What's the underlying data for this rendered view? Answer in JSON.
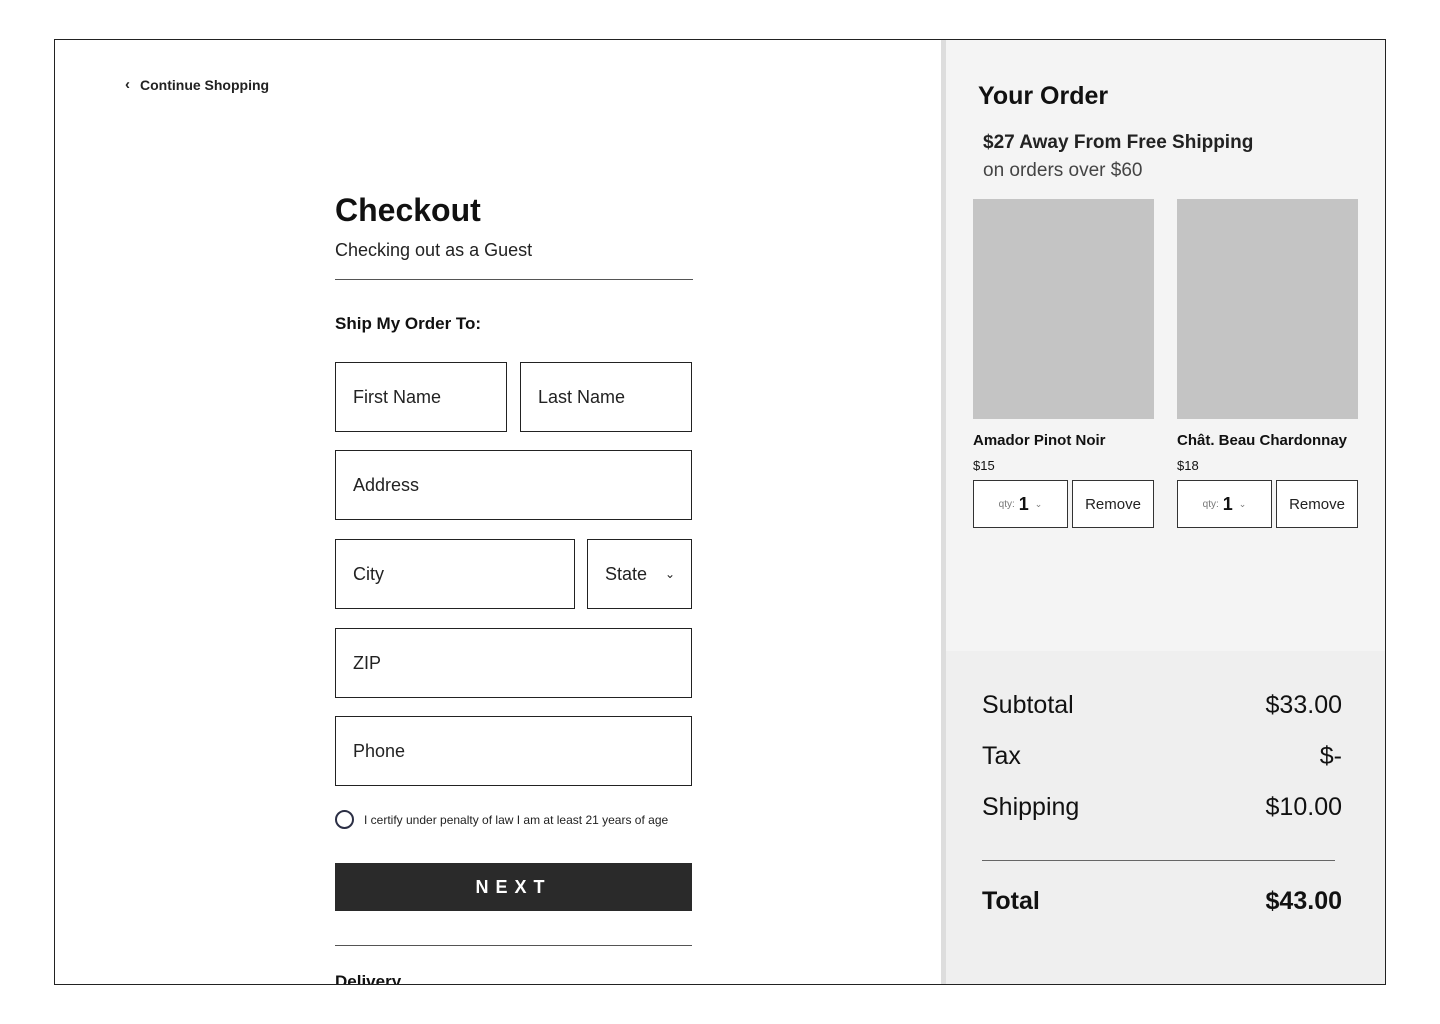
{
  "nav": {
    "continue_label": "Continue Shopping"
  },
  "checkout": {
    "title": "Checkout",
    "subtitle": "Checking out as a Guest",
    "ship_label": "Ship My Order To:",
    "fields": {
      "first_name": "First Name",
      "last_name": "Last Name",
      "address": "Address",
      "city": "City",
      "state": "State",
      "zip": "ZIP",
      "phone": "Phone"
    },
    "certify_label": "I certify under penalty of law I am at least 21 years of age",
    "next_label": "NEXT",
    "delivery_label": "Delivery"
  },
  "order": {
    "title": "Your Order",
    "free_shipping_headline": "$27 Away From Free Shipping",
    "free_shipping_sub": "on orders over $60",
    "items": [
      {
        "name": "Amador Pinot Noir",
        "price": "$15",
        "qty_label": "qty:",
        "qty": "1",
        "remove_label": "Remove"
      },
      {
        "name": "Chât. Beau Chardonnay",
        "price": "$18",
        "qty_label": "qty:",
        "qty": "1",
        "remove_label": "Remove"
      }
    ],
    "summary": {
      "subtotal_label": "Subtotal",
      "subtotal": "$33.00",
      "tax_label": "Tax",
      "tax": "$-",
      "shipping_label": "Shipping",
      "shipping": "$10.00",
      "total_label": "Total",
      "total": "$43.00"
    }
  },
  "colors": {
    "button_bg": "#2a2a2a",
    "panel_bg": "#f4f4f4",
    "summary_bg": "#efefef",
    "placeholder_img": "#c4c4c4"
  },
  "icons": {
    "back": "chevron-left-icon",
    "dropdown": "chevron-down-icon",
    "radio": "radio-icon"
  }
}
